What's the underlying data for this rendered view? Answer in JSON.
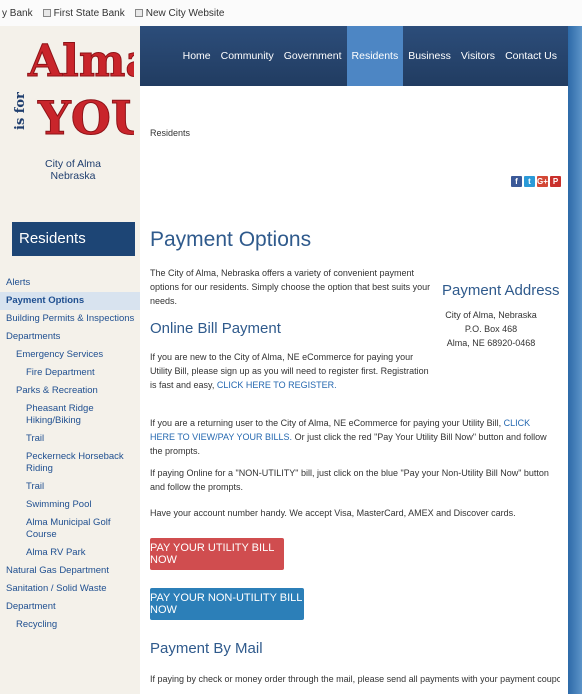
{
  "bookmarks": [
    {
      "label": "y Bank"
    },
    {
      "label": "First State Bank"
    },
    {
      "label": "New City Website"
    }
  ],
  "logo": {
    "alt_text": "Alma is for YOU!"
  },
  "city": {
    "line1": "City of Alma",
    "line2": "Nebraska"
  },
  "nav": [
    "Home",
    "Community",
    "Government",
    "Residents",
    "Business",
    "Visitors",
    "Contact Us"
  ],
  "nav_active": "Residents",
  "breadcrumb": "Residents",
  "socials": [
    {
      "icon": "facebook-icon",
      "glyph": "f",
      "color": "#3b5998"
    },
    {
      "icon": "twitter-icon",
      "glyph": "t",
      "color": "#2b9ad8"
    },
    {
      "icon": "google-plus-icon",
      "glyph": "G+",
      "color": "#d34836"
    },
    {
      "icon": "pinterest-icon",
      "glyph": "P",
      "color": "#c9302c"
    }
  ],
  "sidebar": {
    "title": "Residents",
    "items": [
      {
        "label": "Alerts",
        "indent": 0,
        "active": false
      },
      {
        "label": "Payment Options",
        "indent": 0,
        "active": true
      },
      {
        "label": "Building Permits & Inspections",
        "indent": 0,
        "active": false
      },
      {
        "label": "Departments",
        "indent": 0,
        "active": false
      },
      {
        "label": "Emergency Services",
        "indent": 1,
        "active": false
      },
      {
        "label": "Fire Department",
        "indent": 2,
        "active": false
      },
      {
        "label": "Parks & Recreation",
        "indent": 1,
        "active": false
      },
      {
        "label": "Pheasant Ridge Hiking/Biking",
        "indent": 2,
        "active": false
      },
      {
        "label": "Trail",
        "indent": 2,
        "active": false
      },
      {
        "label": "Peckerneck Horseback Riding",
        "indent": 2,
        "active": false
      },
      {
        "label": "Trail",
        "indent": 2,
        "active": false
      },
      {
        "label": "Swimming Pool",
        "indent": 2,
        "active": false
      },
      {
        "label": "Alma Municipal Golf Course",
        "indent": 2,
        "active": false
      },
      {
        "label": "Alma RV Park",
        "indent": 2,
        "active": false
      },
      {
        "label": "Natural Gas Department",
        "indent": 0,
        "active": false
      },
      {
        "label": "Sanitation / Solid Waste",
        "indent": 0,
        "active": false
      },
      {
        "label": "Department",
        "indent": 0,
        "active": false
      },
      {
        "label": "Recycling",
        "indent": 1,
        "active": false
      }
    ]
  },
  "main": {
    "title": "Payment Options",
    "intro": "The City of Alma, Nebraska offers a variety of convenient payment options for our residents. Simply choose the option that best suits your needs.",
    "online_heading": "Online Bill Payment",
    "new_user_text": "If you are new to the City of Alma, NE eCommerce for paying your Utility Bill, please sign up as you will need to register first. Registration is fast and easy,",
    "register_link": "CLICK HERE TO REGISTER.",
    "returning_text": "If you are a returning user to the City of Alma, NE eCommerce for paying your Utility Bill,",
    "view_link": "CLICK HERE TO VIEW/PAY YOUR BILLS.",
    "returning_text2": "Or just click the red \"Pay Your Utility Bill Now\" button and follow the prompts.",
    "non_utility_text": "If paying Online for a \"NON-UTILITY\" bill, just click on the blue \"Pay your Non-Utility Bill Now\" button and follow the prompts.",
    "accept_text": "Have your account number handy. We accept Visa, MasterCard, AMEX and Discover cards.",
    "btn_utility": "PAY YOUR UTILITY BILL NOW",
    "btn_non_utility": "PAY YOUR NON-UTILITY BILL NOW",
    "mail_heading": "Payment By Mail",
    "mail_text": "If paying by check or money order through the mail, please send all payments with your payment coupon. To avoid late"
  },
  "address": {
    "heading": "Payment Address",
    "line1": "City of Alma, Nebraska",
    "line2": "P.O. Box 468",
    "line3": "Alma, NE 68920-0468"
  }
}
